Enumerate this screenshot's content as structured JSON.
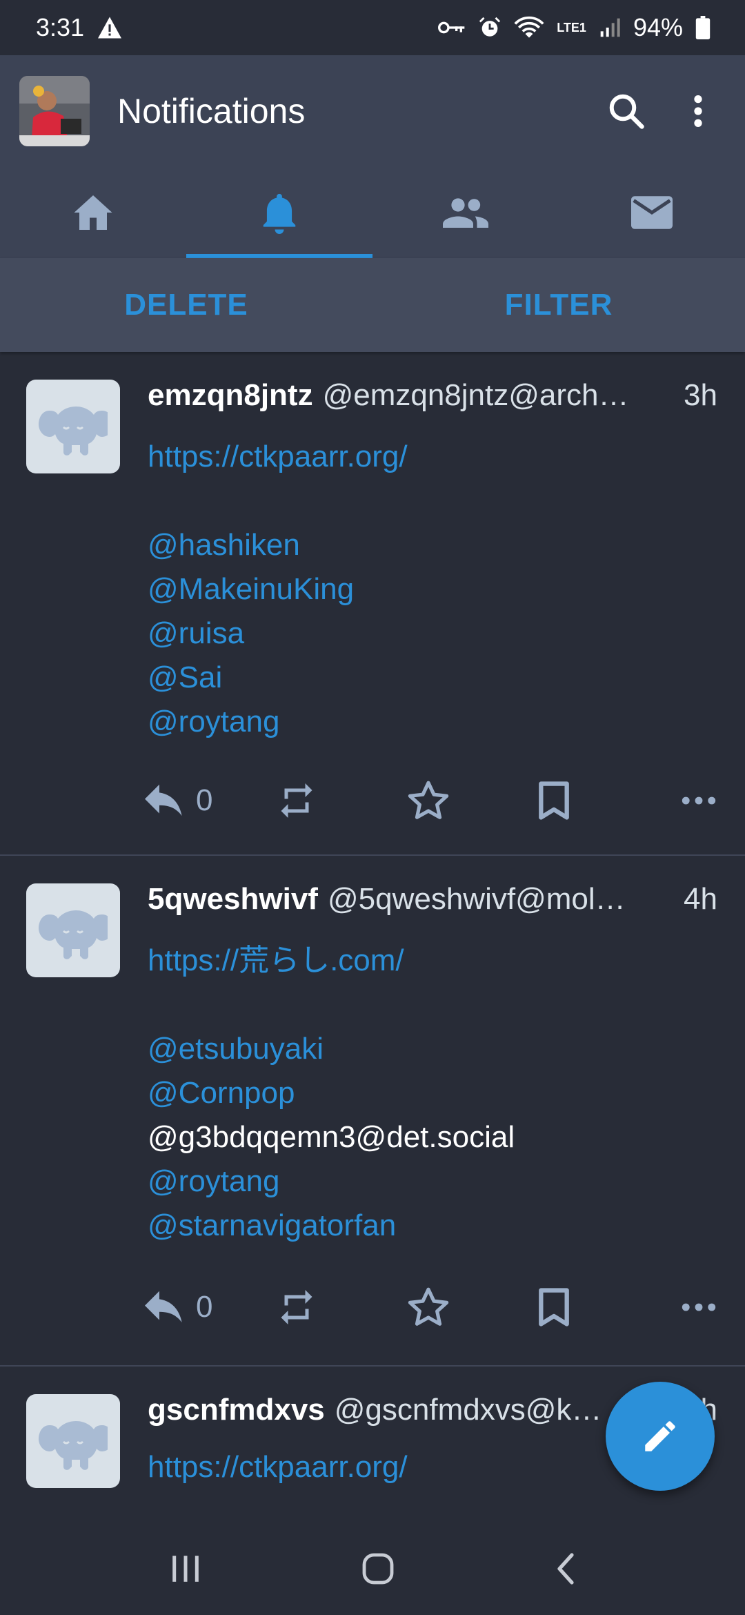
{
  "status_bar": {
    "time": "3:31",
    "battery": "94%",
    "network_label": "LTE1"
  },
  "app_bar": {
    "title": "Notifications",
    "icons": [
      "search-icon",
      "more-vert-icon"
    ]
  },
  "tabs": [
    {
      "name": "home",
      "icon": "home-icon",
      "active": false
    },
    {
      "name": "notifications",
      "icon": "bell-icon",
      "active": true
    },
    {
      "name": "people",
      "icon": "people-icon",
      "active": false
    },
    {
      "name": "messages",
      "icon": "mail-icon",
      "active": false
    }
  ],
  "actions": {
    "delete_label": "DELETE",
    "filter_label": "FILTER"
  },
  "notifications": [
    {
      "name": "emzqn8jntz",
      "acct": "@emzqn8jntz@arch…",
      "time": "3h",
      "link": "https://ctkpaarr.org/",
      "mentions": [
        {
          "text": "@hashiken",
          "is_link": true
        },
        {
          "text": "@MakeinuKing",
          "is_link": true
        },
        {
          "text": "@ruisa",
          "is_link": true
        },
        {
          "text": "@Sai",
          "is_link": true
        },
        {
          "text": "@roytang",
          "is_link": true
        }
      ],
      "reply_count": "0"
    },
    {
      "name": "5qweshwivf",
      "acct": "@5qweshwivf@mol…",
      "time": "4h",
      "link": "https://荒らし.com/",
      "mentions": [
        {
          "text": "@etsubuyaki",
          "is_link": true
        },
        {
          "text": "@Cornpop",
          "is_link": true
        },
        {
          "text": "@g3bdqqemn3@det.social",
          "is_link": false
        },
        {
          "text": "@roytang",
          "is_link": true
        },
        {
          "text": "@starnavigatorfan",
          "is_link": true
        }
      ],
      "reply_count": "0"
    },
    {
      "name": "gscnfmdxvs",
      "acct": "@gscnfmdxvs@k…",
      "time": "h",
      "link": "https://ctkpaarr.org/"
    }
  ],
  "colors": {
    "accent": "#2b90d9",
    "background": "#282c37",
    "appbar": "#3c4355",
    "icon_muted": "#9baec8"
  }
}
